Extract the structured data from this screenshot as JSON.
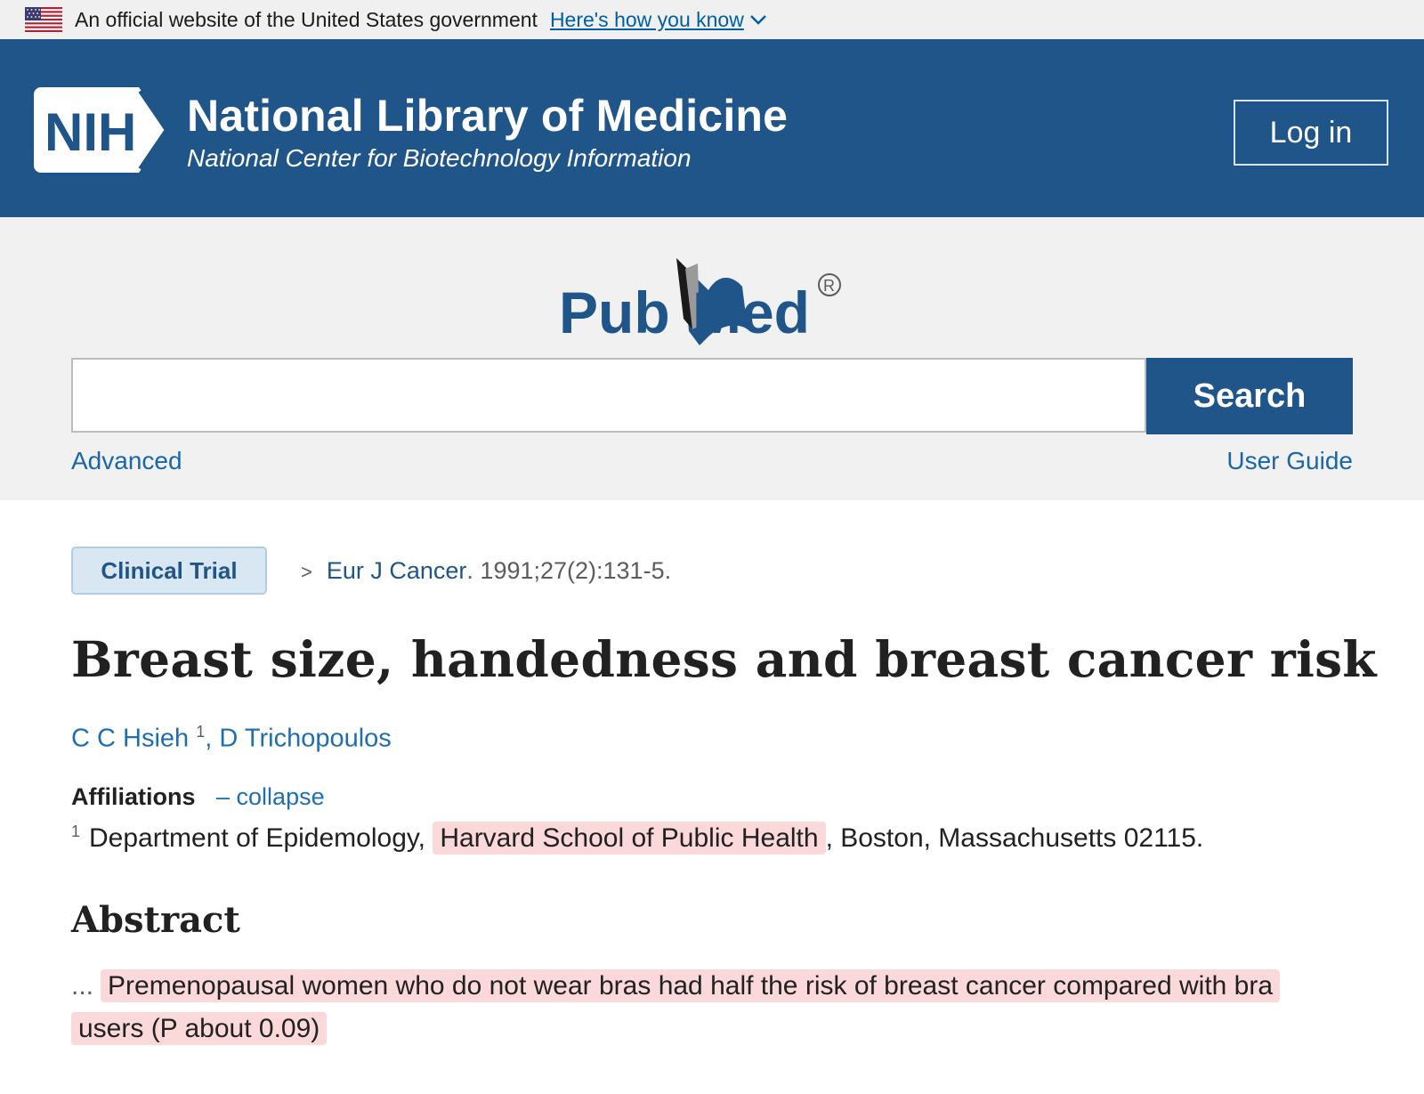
{
  "gov_banner": {
    "text": "An official website of the United States government",
    "link": "Here's how you know"
  },
  "nih_header": {
    "logo_text": "NIH",
    "title": "National Library of Medicine",
    "subtitle": "National Center for Biotechnology Information",
    "login_label": "Log in"
  },
  "pubmed": {
    "logo_left": "Pub",
    "logo_right": "Med",
    "registered": "®"
  },
  "search": {
    "value": "",
    "button_label": "Search",
    "advanced_label": "Advanced",
    "user_guide_label": "User Guide"
  },
  "article": {
    "badge": "Clinical Trial",
    "journal": "Eur J Cancer",
    "citation_rest": ". 1991;27(2):131-5.",
    "title": "Breast size, handedness and breast cancer risk",
    "authors": [
      {
        "name": "C C Hsieh",
        "sup": "1"
      },
      {
        "name": "D Trichopoulos"
      }
    ],
    "affiliations_label": "Affiliations",
    "collapse_label": "– collapse",
    "affiliation": {
      "num": "1",
      "pre": "Department of Epidemology,",
      "highlight": "Harvard School of Public Health",
      "post": ", Boston, Massachusetts 02115."
    },
    "abstract_heading": "Abstract",
    "abstract_ellipsis": "...",
    "abstract_highlight_1": "Premenopausal women who do not wear bras had half the risk of breast cancer compared with bra",
    "abstract_highlight_2": "users (P about 0.09)"
  },
  "colors": {
    "nih_blue": "#20558a",
    "link_blue": "#1f6fae",
    "highlight": "#fbd9da",
    "banner_bg": "#f0f0f0"
  }
}
